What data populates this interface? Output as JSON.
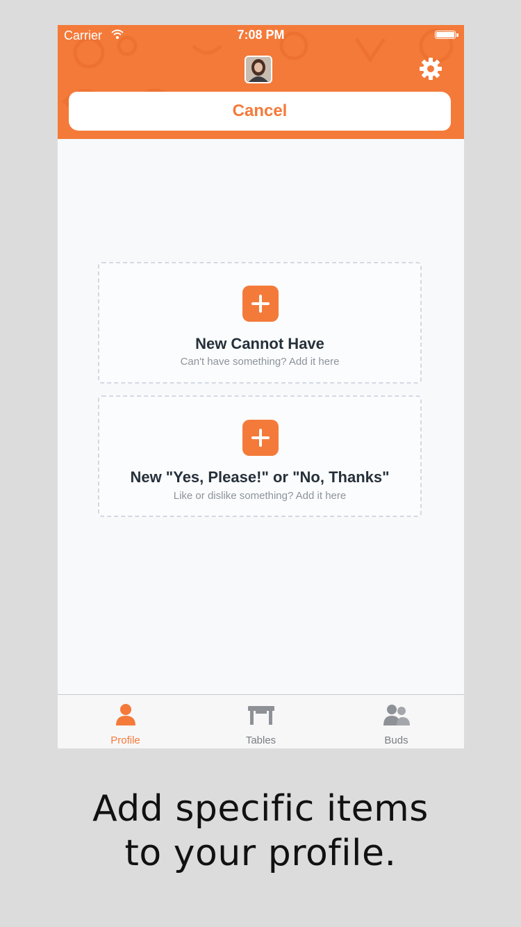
{
  "status_bar": {
    "carrier": "Carrier",
    "time": "7:08 PM",
    "icons": [
      "wifi-icon",
      "battery-icon"
    ]
  },
  "header": {
    "avatar": "avatar-icon",
    "settings_icon": "gear-icon",
    "cancel_label": "Cancel"
  },
  "cards": [
    {
      "title": "New Cannot Have",
      "subtitle": "Can't have something? Add it here",
      "icon": "plus-icon"
    },
    {
      "title": "New \"Yes, Please!\" or \"No, Thanks\"",
      "subtitle": "Like or dislike something? Add it here",
      "icon": "plus-icon"
    }
  ],
  "tabbar": {
    "tabs": [
      {
        "label": "Profile",
        "icon": "person-icon",
        "active": true
      },
      {
        "label": "Tables",
        "icon": "table-icon",
        "active": false
      },
      {
        "label": "Buds",
        "icon": "people-icon",
        "active": false
      }
    ]
  },
  "caption": {
    "line1": "Add specific items",
    "line2": "to your profile."
  },
  "colors": {
    "accent": "#f47a3a",
    "background": "#dcdcdc",
    "screen": "#f7f9fb",
    "inactive_tab": "#7a7d82"
  }
}
